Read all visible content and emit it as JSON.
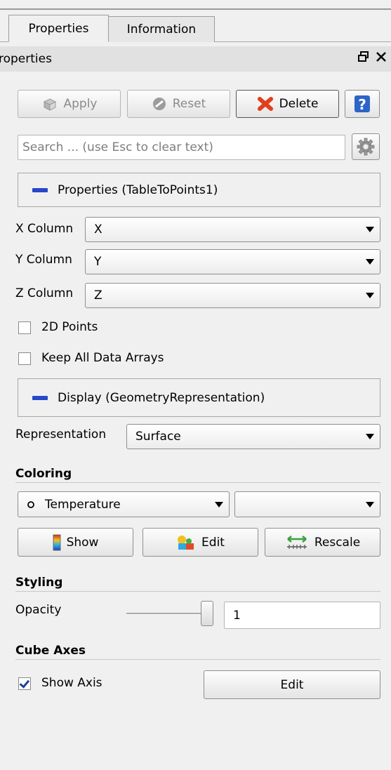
{
  "tabs": [
    {
      "label": "Properties",
      "active": true
    },
    {
      "label": "Information",
      "active": false
    }
  ],
  "panel": {
    "title": "roperties"
  },
  "toolbar": {
    "apply_label": "Apply",
    "reset_label": "Reset",
    "delete_label": "Delete",
    "help_glyph": "?"
  },
  "search": {
    "placeholder": "Search ... (use Esc to clear text)"
  },
  "properties_section": {
    "label": "Properties (TableToPoints1)"
  },
  "columns": {
    "x": {
      "label": "X Column",
      "value": "X"
    },
    "y": {
      "label": "Y Column",
      "value": "Y"
    },
    "z": {
      "label": "Z Column",
      "value": "Z"
    }
  },
  "checks": {
    "points2d": {
      "label": "2D Points",
      "checked": false
    },
    "keep_arrays": {
      "label": "Keep All Data Arrays",
      "checked": false
    }
  },
  "display_section": {
    "label": "Display (GeometryRepresentation)"
  },
  "representation": {
    "label": "Representation",
    "value": "Surface"
  },
  "coloring": {
    "heading": "Coloring",
    "array_value": "Temperature",
    "component_value": "",
    "show_label": "Show",
    "edit_label": "Edit",
    "rescale_label": "Rescale"
  },
  "styling": {
    "heading": "Styling",
    "opacity_label": "Opacity",
    "opacity_value": "1",
    "opacity_fraction": 1
  },
  "cube_axes": {
    "heading": "Cube Axes",
    "show_axis_label": "Show Axis",
    "show_axis_checked": true,
    "edit_label": "Edit"
  },
  "colors": {
    "accent_blue": "#2748c8",
    "delete_red": "#e0401c",
    "help_blue": "#2c64c8"
  }
}
